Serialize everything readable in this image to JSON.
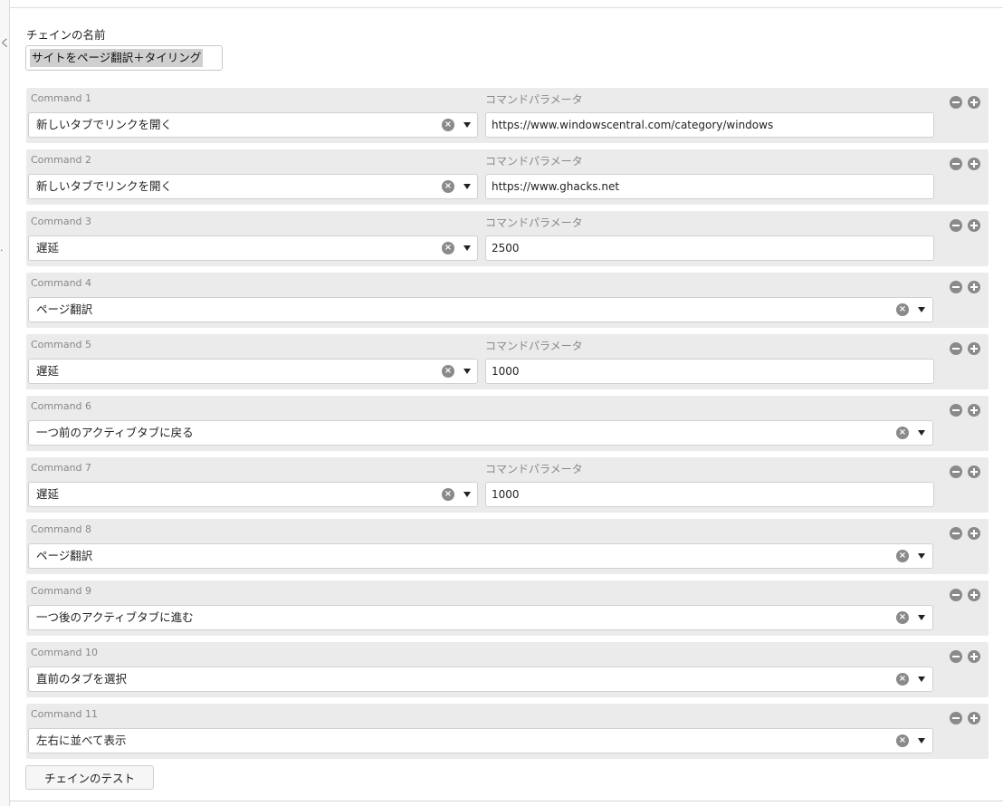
{
  "left_strip": {
    "glyph_top": "く",
    "glyph_mid": "."
  },
  "chain": {
    "label": "チェインの名前",
    "name_value": "サイトをページ翻訳＋タイリング"
  },
  "param_label": "コマンドパラメータ",
  "commands": [
    {
      "label": "Command 1",
      "value": "新しいタブでリンクを開く",
      "param": "https://www.windowscentral.com/category/windows",
      "has_param": true
    },
    {
      "label": "Command 2",
      "value": "新しいタブでリンクを開く",
      "param": "https://www.ghacks.net",
      "has_param": true
    },
    {
      "label": "Command 3",
      "value": "遅延",
      "param": "2500",
      "has_param": true
    },
    {
      "label": "Command 4",
      "value": "ページ翻訳",
      "param": "",
      "has_param": false
    },
    {
      "label": "Command 5",
      "value": "遅延",
      "param": "1000",
      "has_param": true
    },
    {
      "label": "Command 6",
      "value": "一つ前のアクティブタブに戻る",
      "param": "",
      "has_param": false
    },
    {
      "label": "Command 7",
      "value": "遅延",
      "param": "1000",
      "has_param": true
    },
    {
      "label": "Command 8",
      "value": "ページ翻訳",
      "param": "",
      "has_param": false
    },
    {
      "label": "Command 9",
      "value": "一つ後のアクティブタブに進む",
      "param": "",
      "has_param": false
    },
    {
      "label": "Command 10",
      "value": "直前のタブを選択",
      "param": "",
      "has_param": false
    },
    {
      "label": "Command 11",
      "value": "左右に並べて表示",
      "param": "",
      "has_param": false
    }
  ],
  "icons": {
    "clear": "clear-circle-icon",
    "dropdown": "dropdown-arrow-icon",
    "remove": "minus-circle-icon",
    "add": "plus-circle-icon"
  },
  "test_button_label": "チェインのテスト"
}
